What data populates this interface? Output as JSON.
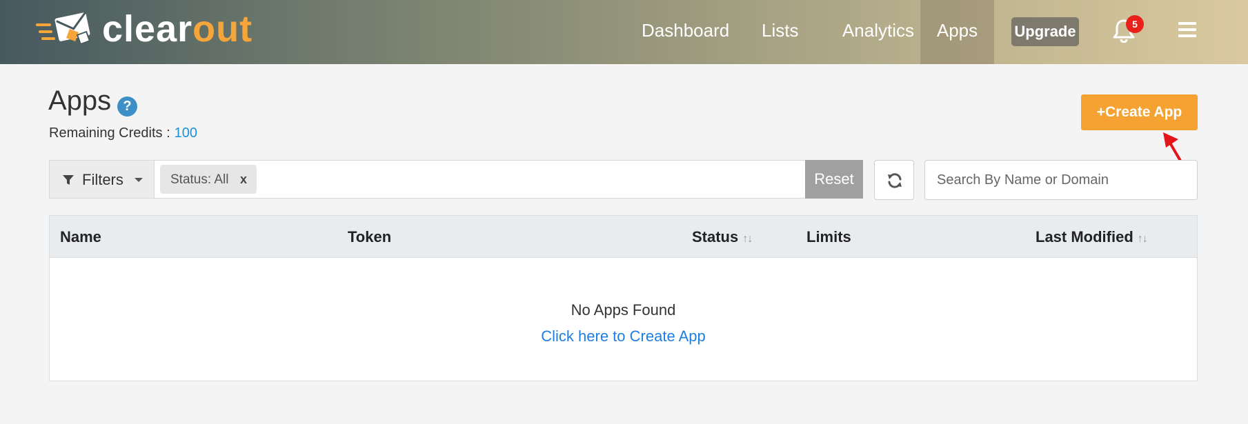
{
  "brand": {
    "logo_text_a": "clear",
    "logo_text_b": "out",
    "accent_color": "#f5a53a"
  },
  "nav": {
    "items": [
      {
        "label": "Dashboard"
      },
      {
        "label": "Lists"
      },
      {
        "label": "Analytics"
      },
      {
        "label": "Apps",
        "active": true
      }
    ],
    "upgrade_label": "Upgrade",
    "notification_count": "5",
    "icons": [
      "bell-icon",
      "hamburger-menu-icon"
    ]
  },
  "page": {
    "title": "Apps",
    "help_glyph": "?",
    "credits_label": "Remaining Credits :",
    "credits_value": "100",
    "create_button_label": "Create App",
    "create_button_glyph": "+",
    "create_button_color": "#f6a232"
  },
  "filters": {
    "button_label": "Filters",
    "chip_label": "Status: All",
    "chip_remove": "x",
    "reset_label": "Reset",
    "refresh_icon": "refresh-icon",
    "search_placeholder": "Search By Name or Domain"
  },
  "table": {
    "columns": [
      {
        "label": "Name"
      },
      {
        "label": "Token"
      },
      {
        "label": "Status",
        "sortable": true
      },
      {
        "label": "Limits"
      },
      {
        "label": "Last Modified",
        "sortable": true
      }
    ],
    "sort_glyph": "↑↓",
    "empty_message": "No Apps Found",
    "empty_link": "Click here to Create App"
  }
}
